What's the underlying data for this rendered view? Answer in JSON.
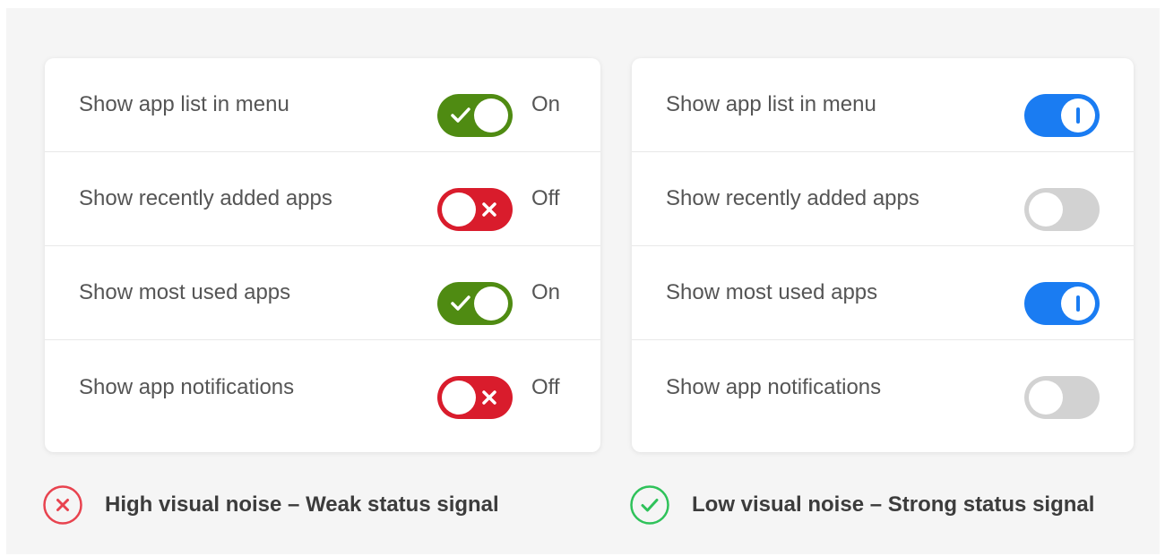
{
  "left_panel": {
    "rows": [
      {
        "label": "Show app list in menu",
        "state": "On"
      },
      {
        "label": "Show recently added apps",
        "state": "Off"
      },
      {
        "label": "Show most used apps",
        "state": "On"
      },
      {
        "label": "Show app notifications",
        "state": "Off"
      }
    ],
    "caption": "High visual noise – Weak status signal"
  },
  "right_panel": {
    "rows": [
      {
        "label": "Show app list in menu",
        "state": "on"
      },
      {
        "label": "Show recently added apps",
        "state": "off"
      },
      {
        "label": "Show most used apps",
        "state": "on"
      },
      {
        "label": "Show app notifications",
        "state": "off"
      }
    ],
    "caption": "Low visual noise – Strong status signal"
  },
  "colors": {
    "left_on": "#4f8b12",
    "left_off": "#d91c2c",
    "right_on": "#1a7cf2",
    "right_off": "#d2d2d2",
    "bad": "#e8434f",
    "good": "#2fc25a"
  },
  "icons": {
    "left_on_glyph": "check-icon",
    "left_off_glyph": "x-icon",
    "right_on_glyph": "bar-icon",
    "left_caption": "x-circle-icon",
    "right_caption": "check-circle-icon"
  }
}
